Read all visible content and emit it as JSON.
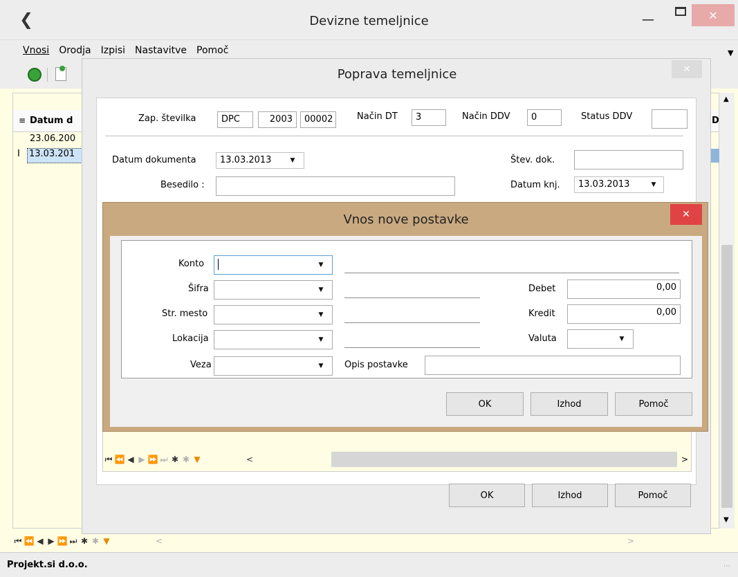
{
  "main_window": {
    "title": "Devizne temeljnice",
    "menu": [
      "Vnosi",
      "Orodja",
      "Izpisi",
      "Nastavitve",
      "Pomoč"
    ],
    "table": {
      "column_header": "Datum d",
      "right_header": "D",
      "rows": [
        "23.06.200",
        "13.03.201"
      ]
    },
    "status_text": "Projekt.si d.o.o."
  },
  "edit_dialog": {
    "title": "Poprava temeljnice",
    "zap_label": "Zap. številka",
    "zap_values": [
      "DPC",
      "2003",
      "00002"
    ],
    "nacin_dt_label": "Način DT",
    "nacin_dt_value": "3",
    "nacin_ddv_label": "Način DDV",
    "nacin_ddv_value": "0",
    "status_ddv_label": "Status DDV",
    "status_ddv_value": "",
    "datum_dok_label": "Datum dokumenta",
    "datum_dok_value": "13.03.2013",
    "stev_dok_label": "Štev. dok.",
    "stev_dok_value": "",
    "besedilo_label": "Besedilo :",
    "besedilo_value": "",
    "datum_knj_label": "Datum knj.",
    "datum_knj_value": "13.03.2013",
    "ok": "OK",
    "izhod": "Izhod",
    "pomoc": "Pomoč"
  },
  "entry_dialog": {
    "title": "Vnos nove postavke",
    "konto_label": "Konto",
    "sifra_label": "Šifra",
    "str_mesto_label": "Str. mesto",
    "lokacija_label": "Lokacija",
    "veza_label": "Veza",
    "debet_label": "Debet",
    "debet_value": "0,00",
    "kredit_label": "Kredit",
    "kredit_value": "0,00",
    "valuta_label": "Valuta",
    "opis_label": "Opis postavke",
    "opis_value": "",
    "ok": "OK",
    "izhod": "Izhod",
    "pomoc": "Pomoč"
  },
  "colors": {
    "entry_frame": "#c9a97f",
    "selection": "#cde3f7",
    "close_red": "#e04343",
    "pale_yellow": "#fffde4"
  }
}
